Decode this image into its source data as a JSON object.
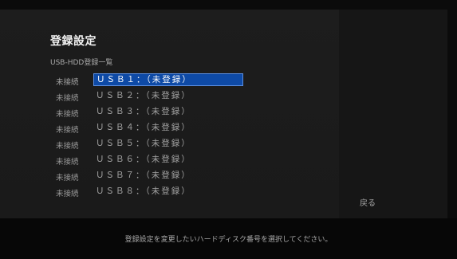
{
  "header": {
    "title": "登録設定",
    "subtitle": "USB-HDD登録一覧"
  },
  "usb_list": {
    "items": [
      {
        "status": "未接続",
        "label": "ＵＳＢ１：（未登録）",
        "selected": true
      },
      {
        "status": "未接続",
        "label": "ＵＳＢ２：（未登録）",
        "selected": false
      },
      {
        "status": "未接続",
        "label": "ＵＳＢ３：（未登録）",
        "selected": false
      },
      {
        "status": "未接続",
        "label": "ＵＳＢ４：（未登録）",
        "selected": false
      },
      {
        "status": "未接続",
        "label": "ＵＳＢ５：（未登録）",
        "selected": false
      },
      {
        "status": "未接続",
        "label": "ＵＳＢ６：（未登録）",
        "selected": false
      },
      {
        "status": "未接続",
        "label": "ＵＳＢ７：（未登録）",
        "selected": false
      },
      {
        "status": "未接続",
        "label": "ＵＳＢ８：（未登録）",
        "selected": false
      }
    ]
  },
  "side_menu": {
    "back_label": "戻る"
  },
  "help": {
    "text": "登録設定を変更したいハードディスク番号を選択してください。"
  },
  "colors": {
    "selection_fill": "#0e4aa6",
    "selection_border": "#5c8fe0",
    "panel_bg": "#1c1c1c",
    "side_panel_bg": "#161616"
  }
}
